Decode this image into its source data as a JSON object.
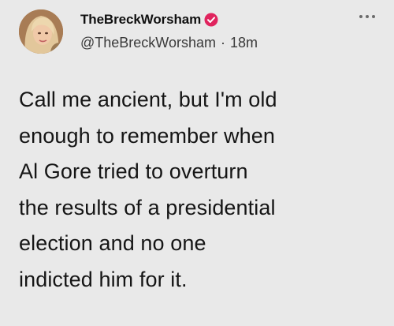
{
  "author": {
    "display_name": "TheBreckWorsham",
    "handle": "@TheBreckWorsham",
    "separator": "·",
    "time": "18m",
    "verified": true,
    "verified_color": "#e0245e"
  },
  "icons": {
    "more": "more-dots-icon",
    "verified": "verified-badge-icon",
    "avatar": "profile-avatar"
  },
  "tweet": {
    "lines": [
      "Call me ancient, but I'm old",
      "enough to remember when",
      "Al Gore tried to overturn",
      "the results of a presidential",
      "election and no one",
      "indicted him for it."
    ]
  }
}
